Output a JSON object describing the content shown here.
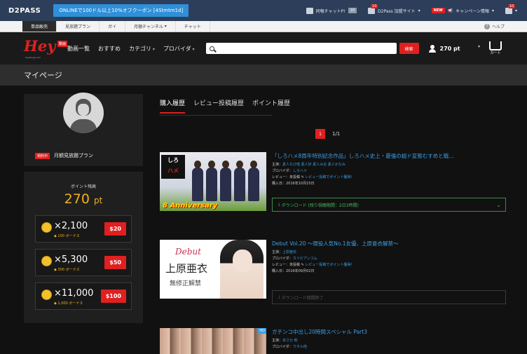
{
  "d2pass": {
    "logo": "D2PASS",
    "promo": "ONLINEで100ドル以上10%オフクーポン [4Stmtm1d]",
    "items": [
      {
        "label": "同報チャットP!",
        "count": "10"
      },
      {
        "label": "D2Pass 加盟サイト",
        "badge": "10"
      },
      {
        "label": "キャンペーン情報",
        "tag": "NEW"
      }
    ],
    "user_badge": "10"
  },
  "tabs": [
    "単品販売",
    "見放題プラン",
    "ガイ",
    "月額チャンネル",
    "チャット"
  ],
  "help": "ヘルプ",
  "header": {
    "logo": "Hey",
    "logo_tag": "動画",
    "logo_sub": "heydouga.com",
    "nav": [
      "動画一覧",
      "おすすめ",
      "カテゴリ",
      "プロバイダ"
    ],
    "search_placeholder": "",
    "search_button": "検索",
    "points": "270 pt",
    "cart_label": "カート"
  },
  "page_title": "マイページ",
  "profile": {
    "plan_badge": "契約中",
    "plan_name": "月額見放題プラン"
  },
  "points_box": {
    "label": "ポイント残高",
    "value": "270",
    "unit": "pt",
    "packages": [
      {
        "amount": "×2,100",
        "bonus": "◆ 100 ボーナス",
        "price": "$20"
      },
      {
        "amount": "×5,300",
        "bonus": "◆ 300 ボーナス",
        "price": "$50"
      },
      {
        "amount": "×11,000",
        "bonus": "◆ 1,000 ボーナス",
        "price": "$100"
      }
    ]
  },
  "history_tabs": [
    "購入履歴",
    "レビュー投稿履歴",
    "ポイント履歴"
  ],
  "pager": {
    "current": "1",
    "total": "1/1"
  },
  "items": [
    {
      "title": "「しろハメ8周年特別記念作品」しろハメ史上・最強の超ド変態むすめと戦…",
      "cast_label": "主演：",
      "cast": "素人なび他 素人妙 素人みお 素人かなみ",
      "provider_label": "プロバイダ：",
      "provider": "しろハメ",
      "review_label": "レビュー：未投稿",
      "review_link": "レビュー投稿でポイント獲得！",
      "date": "購入日：2016年10月15日",
      "download": "ダウンロード (残り視聴期間：2日3時間)",
      "thumb_a": "しろ",
      "thumb_b": "ハメ",
      "thumb_c": "8 Anniversary"
    },
    {
      "title": "Debut Vol.20 ～現役人気No.1女優、上原亜衣解禁～",
      "cast_label": "主演：",
      "cast": "上原亜衣",
      "provider_label": "プロバイダ：",
      "provider": "カリビアンコム",
      "review_label": "レビュー：未投稿",
      "review_link": "レビュー投稿でポイント獲得！",
      "date": "購入日：2016年09月02日",
      "download": "ダウンロード期間終了",
      "thumb_a": "Debut",
      "thumb_b": "上原亜衣",
      "thumb_c": "無修正解禁"
    },
    {
      "title": "ガチンコ中出し20時間スペシャル Part3",
      "cast_label": "主演：",
      "cast": "あさか 他",
      "provider_label": "プロバイダ：",
      "provider": "ウタル他",
      "thumb_tag": "HD"
    }
  ]
}
